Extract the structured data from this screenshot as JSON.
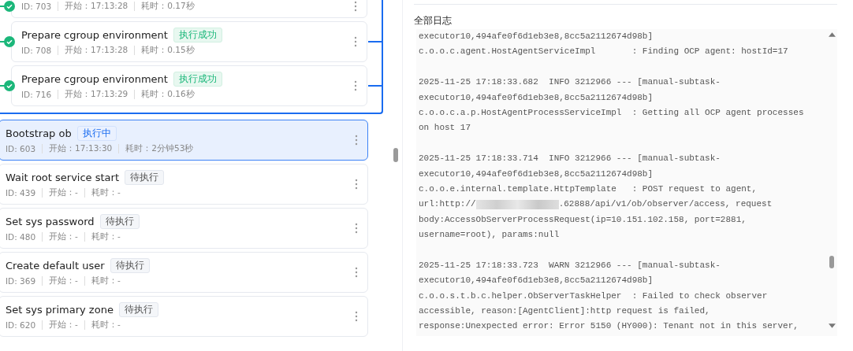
{
  "task_group": [
    {
      "kind": "success",
      "id": "ID: 703",
      "start": "开始：17:13:28",
      "duration": "耗时：0.17秒"
    },
    {
      "kind": "success",
      "title": "Prepare cgroup environment",
      "tag": "执行成功",
      "id": "ID: 708",
      "start": "开始：17:13:28",
      "duration": "耗时：0.15秒"
    },
    {
      "kind": "success",
      "title": "Prepare cgroup environment",
      "tag": "执行成功",
      "id": "ID: 716",
      "start": "开始：17:13:29",
      "duration": "耗时：0.16秒"
    }
  ],
  "tasks": [
    {
      "kind": "running",
      "selected": true,
      "title": "Bootstrap ob",
      "tag": "执行中",
      "id": "ID: 603",
      "start": "开始：17:13:30",
      "duration": "耗时：2分钟53秒"
    },
    {
      "kind": "pending",
      "selected": false,
      "title": "Wait root service start",
      "tag": "待执行",
      "id": "ID: 439",
      "start": "开始：-",
      "duration": "耗时：-"
    },
    {
      "kind": "pending",
      "selected": false,
      "title": "Set sys password",
      "tag": "待执行",
      "id": "ID: 480",
      "start": "开始：-",
      "duration": "耗时：-"
    },
    {
      "kind": "pending",
      "selected": false,
      "title": "Create default user",
      "tag": "待执行",
      "id": "ID: 369",
      "start": "开始：-",
      "duration": "耗时：-"
    },
    {
      "kind": "pending",
      "selected": false,
      "title": "Set sys primary zone",
      "tag": "待执行",
      "id": "ID: 620",
      "start": "开始：-",
      "duration": "耗时：-"
    }
  ],
  "log": {
    "title": "全部日志",
    "entries": [
      {
        "lines": [
          {
            "kind": "text",
            "text": "executor10,494afe0f6d1eb3e8,8cc5a2112674d98b]"
          },
          {
            "kind": "text",
            "text": "c.o.o.c.agent.HostAgentServiceImpl       : Finding OCP agent: hostId=17"
          }
        ]
      },
      {
        "lines": [
          {
            "kind": "text",
            "text": "2025-11-25 17:18:33.682  INFO 3212966 --- [manual-subtask-"
          },
          {
            "kind": "text",
            "text": "executor10,494afe0f6d1eb3e8,8cc5a2112674d98b]"
          },
          {
            "kind": "text",
            "text": "c.o.o.c.a.p.HostAgentProcessServiceImpl  : Getting all OCP agent processes"
          },
          {
            "kind": "text",
            "text": "on host 17"
          }
        ]
      },
      {
        "lines": [
          {
            "kind": "text",
            "text": "2025-11-25 17:18:33.714  INFO 3212966 --- [manual-subtask-"
          },
          {
            "kind": "text",
            "text": "executor10,494afe0f6d1eb3e8,8cc5a2112674d98b]"
          },
          {
            "kind": "text",
            "text": "c.o.o.e.internal.template.HttpTemplate   : POST request to agent,"
          },
          {
            "kind": "redacted",
            "before": "url:http://",
            "after": ".62888/api/v1/ob/observer/access, request"
          },
          {
            "kind": "text",
            "text": "body:AccessObServerProcessRequest(ip=10.151.102.158, port=2881,"
          },
          {
            "kind": "text",
            "text": "username=root), params:null"
          }
        ]
      },
      {
        "lines": [
          {
            "kind": "text",
            "text": "2025-11-25 17:18:33.723  WARN 3212966 --- [manual-subtask-"
          },
          {
            "kind": "text",
            "text": "executor10,494afe0f6d1eb3e8,8cc5a2112674d98b]"
          },
          {
            "kind": "text",
            "text": "c.o.o.s.t.b.c.helper.ObServerTaskHelper  : Failed to check observer"
          },
          {
            "kind": "text",
            "text": "accessible, reason:[AgentClient]:http request is failed,"
          },
          {
            "kind": "text",
            "text": "response:Unexpected error: Error 5150 (HY000): Tenant not in this server,"
          }
        ]
      }
    ]
  }
}
